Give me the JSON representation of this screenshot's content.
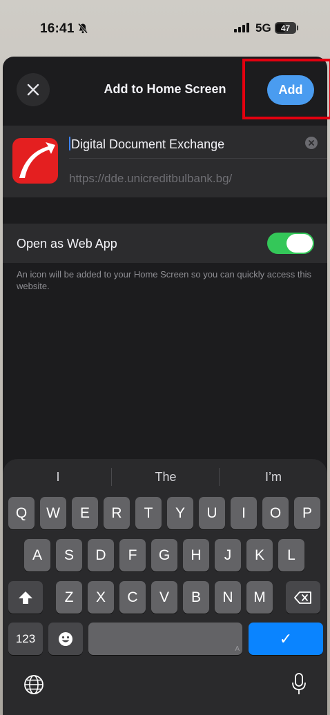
{
  "status_bar": {
    "time": "16:41",
    "network": "5G",
    "battery": "47"
  },
  "sheet": {
    "title": "Add to Home Screen",
    "add_label": "Add"
  },
  "bookmark": {
    "name": "Digital Document Exchange",
    "url": "https://dde.unicreditbulbank.bg/"
  },
  "web_app": {
    "label": "Open as Web App",
    "enabled": true,
    "hint": "An icon will be added to your Home Screen so you can quickly access this website."
  },
  "keyboard": {
    "suggestions": [
      "I",
      "The",
      "I’m"
    ],
    "row1": [
      "Q",
      "W",
      "E",
      "R",
      "T",
      "Y",
      "U",
      "I",
      "O",
      "P"
    ],
    "row2": [
      "A",
      "S",
      "D",
      "F",
      "G",
      "H",
      "J",
      "K",
      "L"
    ],
    "row3": [
      "Z",
      "X",
      "C",
      "V",
      "B",
      "N",
      "M"
    ],
    "numbers_label": "123",
    "space_mark": "A",
    "return_glyph": "✓"
  },
  "colors": {
    "accent": "#4a9cf0",
    "toggle_on": "#34c759",
    "brand_red": "#e41f20",
    "highlight": "#e3000f"
  }
}
